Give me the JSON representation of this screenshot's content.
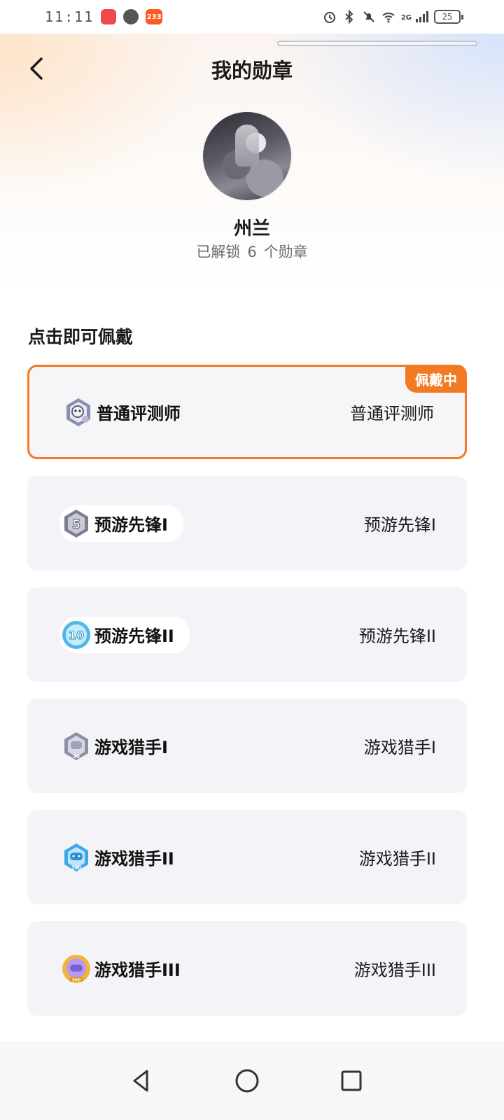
{
  "status_bar": {
    "time": "11:11",
    "battery": "25",
    "network": "2G"
  },
  "header": {
    "title": "我的勋章"
  },
  "profile": {
    "name": "州兰",
    "unlock_prefix": "已解锁",
    "unlock_count": "6",
    "unlock_suffix": "个勋章"
  },
  "section": {
    "title": "点击即可佩戴"
  },
  "badges": [
    {
      "name": "普通评测师",
      "label": "普通评测师",
      "wearing": true,
      "wearing_label": "佩戴中",
      "icon": "reviewer-medal-icon",
      "color": "#8a8fb0"
    },
    {
      "name": "预游先锋I",
      "label": "预游先锋I",
      "icon": "pioneer-5-medal-icon",
      "color": "#7c7f92",
      "number": "5"
    },
    {
      "name": "预游先锋II",
      "label": "预游先锋II",
      "icon": "pioneer-10-medal-icon",
      "color": "#4fb8e6",
      "number": "10"
    },
    {
      "name": "游戏猎手I",
      "label": "游戏猎手I",
      "icon": "hunter-30-medal-icon",
      "color": "#8d8fa6",
      "number": "30"
    },
    {
      "name": "游戏猎手II",
      "label": "游戏猎手II",
      "icon": "hunter-100-medal-icon",
      "color": "#3fa8e8",
      "number": "100"
    },
    {
      "name": "游戏猎手III",
      "label": "游戏猎手III",
      "icon": "hunter-300-medal-icon",
      "color": "#f2b53a",
      "number": "300"
    }
  ],
  "colors": {
    "accent": "#f27a24",
    "card_bg": "#f4f4f8"
  }
}
